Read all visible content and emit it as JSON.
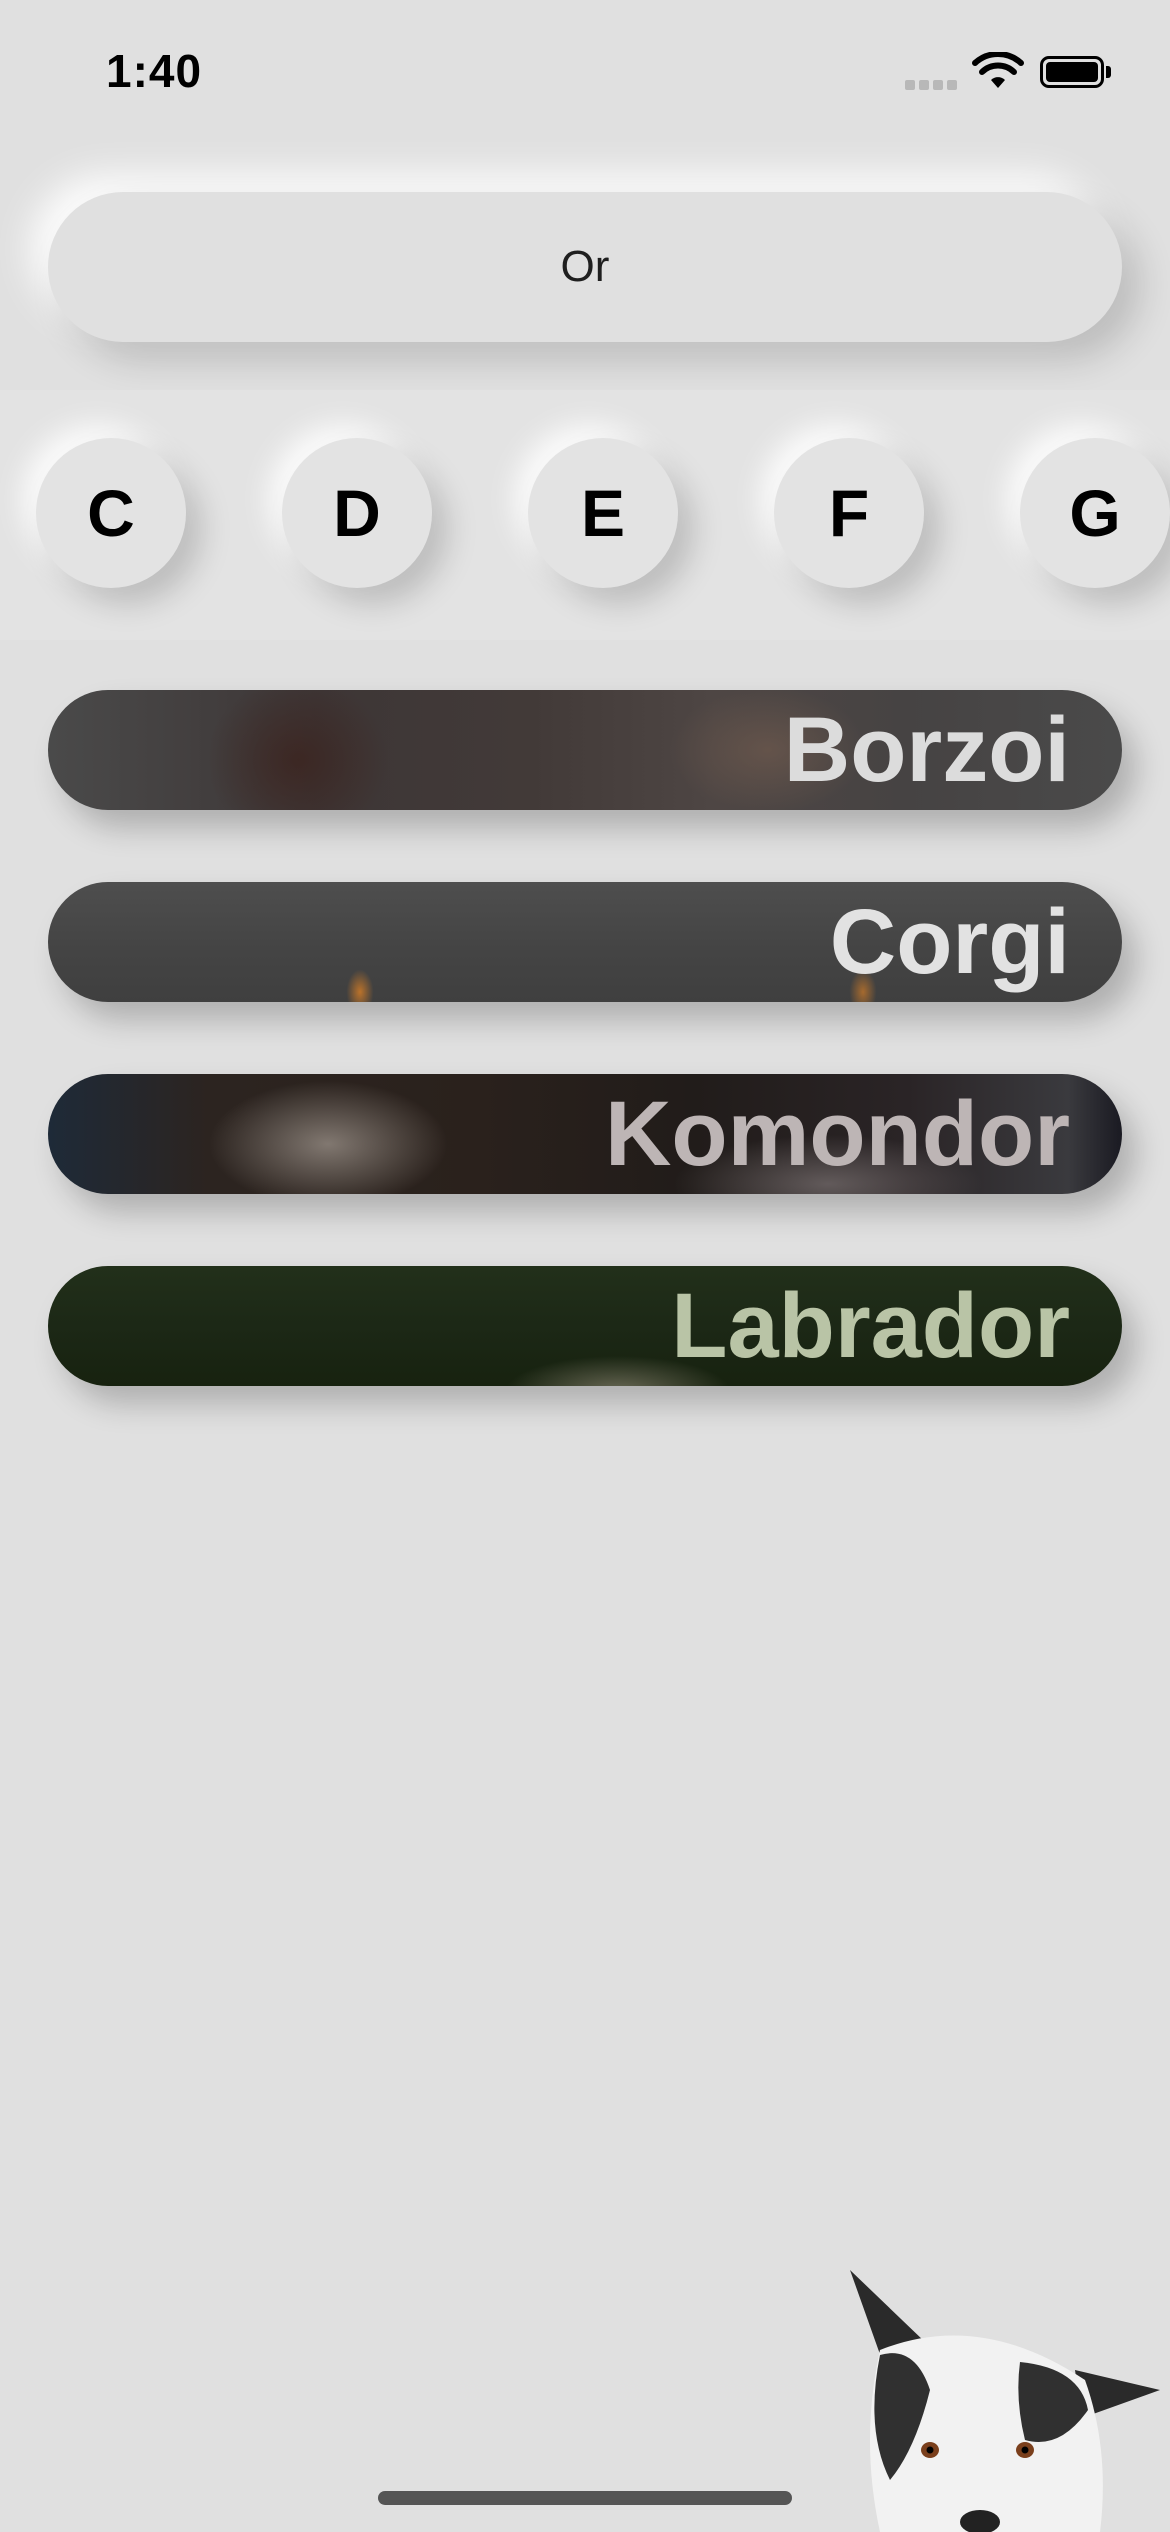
{
  "status_bar": {
    "time": "1:40",
    "icons": [
      "cellular-signal-icon",
      "wifi-icon",
      "battery-icon"
    ]
  },
  "or_button": {
    "label": "Or"
  },
  "letters": [
    "C",
    "D",
    "E",
    "F",
    "G"
  ],
  "breeds": [
    {
      "label": "Borzoi"
    },
    {
      "label": "Corgi"
    },
    {
      "label": "Komondor"
    },
    {
      "label": "Labrador"
    }
  ],
  "colors": {
    "background": "#e0e0e0",
    "text": "#000000"
  }
}
